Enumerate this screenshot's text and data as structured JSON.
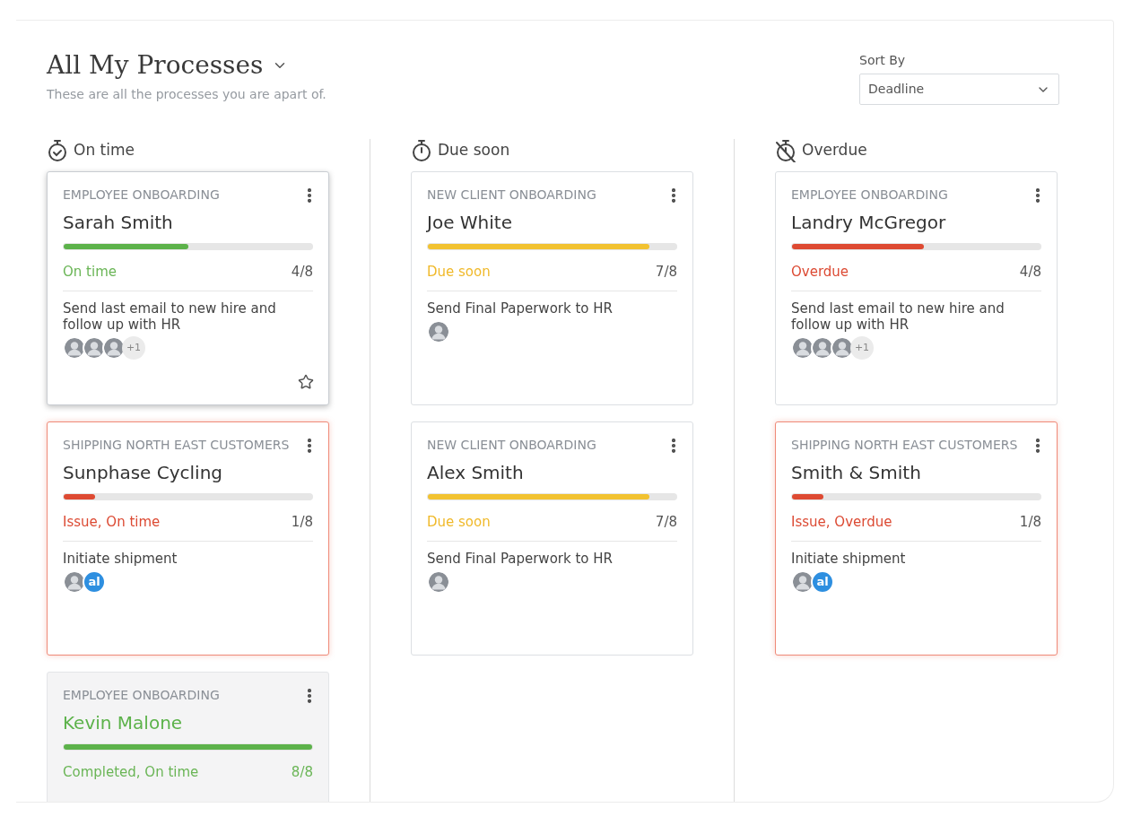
{
  "header": {
    "title": "All My Processes",
    "subtitle": "These are all the processes you are apart of."
  },
  "sort": {
    "label": "Sort By",
    "value": "Deadline"
  },
  "columns": [
    {
      "kind": "ontime",
      "title": "On time",
      "cards": [
        {
          "category": "EMPLOYEE ONBOARDING",
          "name": "Sarah Smith",
          "level": 0.5,
          "status": "On time",
          "kind": "ontime",
          "progress": "4/8",
          "task": "Send last email to new hire and follow up with HR",
          "highlighted": true,
          "assignees": [
            {
              "kind": "photo"
            },
            {
              "kind": "photo"
            },
            {
              "kind": "photo"
            },
            {
              "kind": "more",
              "label": "+1"
            }
          ]
        },
        {
          "category": "SHIPPING NORTH EAST CUSTOMERS",
          "name": "Sunphase Cycling",
          "level": 0.125,
          "status": "Issue, On time",
          "kind": "issue",
          "progress": "1/8",
          "task": "Initiate shipment",
          "highlighted": false,
          "assignees": [
            {
              "kind": "photo"
            },
            {
              "kind": "initials",
              "label": "al"
            }
          ]
        },
        {
          "category": "EMPLOYEE ONBOARDING",
          "name": "Kevin Malone",
          "level": 1,
          "status": "Completed, On time",
          "kind": "completed",
          "progress": "8/8",
          "highlighted": false
        }
      ]
    },
    {
      "kind": "duesoon",
      "title": "Due soon",
      "cards": [
        {
          "category": "NEW CLIENT ONBOARDING",
          "name": "Joe White",
          "level": 0.89,
          "status": "Due soon",
          "kind": "duesoon",
          "progress": "7/8",
          "task": "Send Final Paperwork to HR",
          "highlighted": false,
          "assignees": [
            {
              "kind": "photo"
            }
          ]
        },
        {
          "category": "NEW CLIENT ONBOARDING",
          "name": "Alex Smith",
          "level": 0.89,
          "status": "Due soon",
          "kind": "duesoon",
          "progress": "7/8",
          "task": "Send Final Paperwork to HR",
          "highlighted": false,
          "assignees": [
            {
              "kind": "photo"
            }
          ]
        }
      ]
    },
    {
      "kind": "overdue",
      "title": "Overdue",
      "cards": [
        {
          "category": "EMPLOYEE ONBOARDING",
          "name": "Landry McGregor",
          "level": 0.53,
          "status": "Overdue",
          "kind": "overdue",
          "progress": "4/8",
          "task": "Send last email to new hire and follow up with HR",
          "highlighted": false,
          "assignees": [
            {
              "kind": "photo"
            },
            {
              "kind": "photo"
            },
            {
              "kind": "photo"
            },
            {
              "kind": "more",
              "label": "+1"
            }
          ]
        },
        {
          "category": "SHIPPING NORTH EAST CUSTOMERS",
          "name": "Smith & Smith",
          "level": 0.125,
          "status": "Issue, Overdue",
          "kind": "issue",
          "progress": "1/8",
          "task": "Initiate shipment",
          "highlighted": false,
          "assignees": [
            {
              "kind": "photo"
            },
            {
              "kind": "initials",
              "label": "al"
            }
          ]
        }
      ]
    }
  ]
}
